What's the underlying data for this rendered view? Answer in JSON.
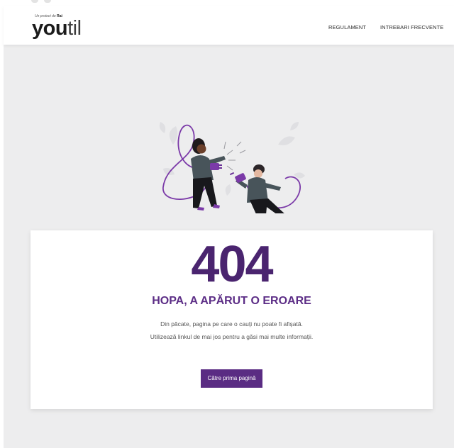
{
  "header": {
    "logo": {
      "tagline_prefix": "Un proiect de",
      "tagline_brand": "Rai",
      "word_bold": "you",
      "word_light": "til"
    },
    "nav": [
      {
        "label": "REGULAMENT"
      },
      {
        "label": "INTREBARI FRECVENTE"
      }
    ]
  },
  "error": {
    "code": "404",
    "title": "HOPA, A APĂRUT O EROARE",
    "message_line1": "Din păcate, pagina pe care o cauți nu poate fi afișată.",
    "message_line2": "Utilizează linkul de mai jos pentru a găsi mai multe informații.",
    "button_label": "Către prima pagină"
  },
  "colors": {
    "brand_purple": "#5a2c83",
    "code_purple": "#4a246f",
    "background": "#ededee"
  },
  "icons": {
    "illustration": "two-people-connecting-plug-illustration"
  }
}
